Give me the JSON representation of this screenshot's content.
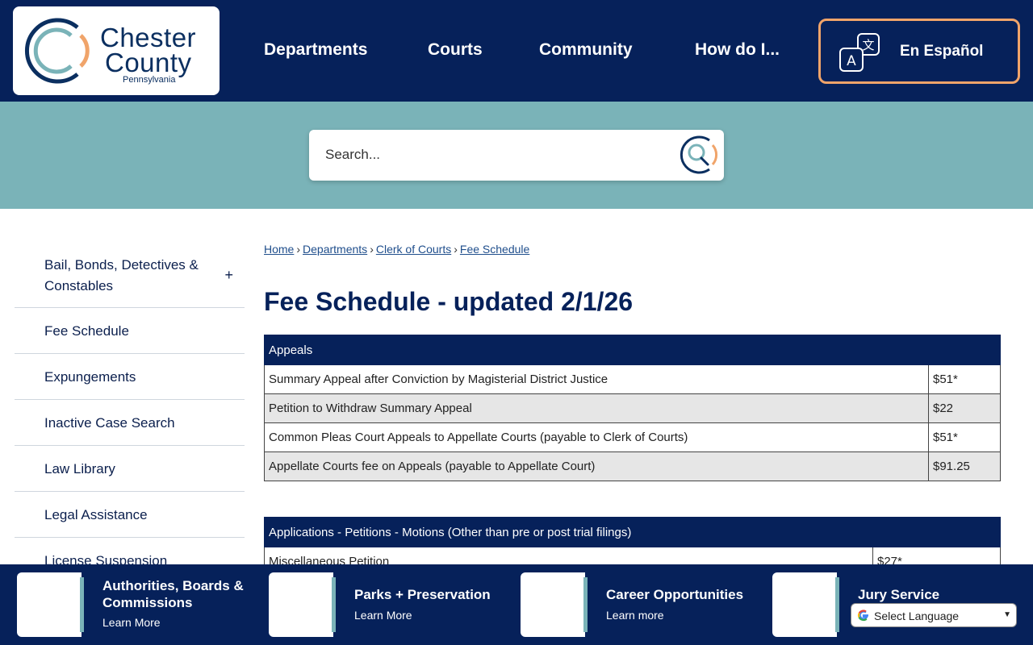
{
  "logo": {
    "line1": "Chester",
    "line2": "County",
    "line3": "Pennsylvania"
  },
  "nav": [
    "Departments",
    "Courts",
    "Community",
    "How do I..."
  ],
  "espanol": "En Español",
  "search": {
    "placeholder": "Search..."
  },
  "sidebar": {
    "items": [
      "Bail, Bonds, Detectives & Constables",
      "Fee Schedule",
      "Expungements",
      "Inactive Case Search",
      "Law Library",
      "Legal Assistance",
      "License Suspension"
    ],
    "expand_symbol": "+"
  },
  "breadcrumb": [
    "Home",
    "Departments",
    "Clerk of Courts",
    "Fee Schedule"
  ],
  "page_title": "Fee Schedule - updated 2/1/26",
  "tables": [
    {
      "header": "Appeals",
      "rows": [
        [
          "Summary Appeal after Conviction by Magisterial District Justice",
          "$51*"
        ],
        [
          "Petition to Withdraw Summary Appeal",
          "$22"
        ],
        [
          "Common Pleas Court Appeals to Appellate Courts (payable to Clerk of Courts)",
          "$51*"
        ],
        [
          "Appellate Courts fee on Appeals (payable to Appellate Court)",
          "$91.25"
        ]
      ]
    },
    {
      "header": "Applications - Petitions - Motions (Other than pre or post trial filings)",
      "rows": [
        [
          "Miscellaneous Petition",
          "$27*"
        ]
      ]
    }
  ],
  "footer_cards": [
    {
      "title": "Authorities, Boards & Commissions",
      "sub": "Learn More"
    },
    {
      "title": "Parks + Preservation",
      "sub": "Learn More"
    },
    {
      "title": "Career Opportunities",
      "sub": "Learn more"
    },
    {
      "title": "Jury Service",
      "sub": ""
    }
  ],
  "translate": {
    "label": "Select Language"
  },
  "colors": {
    "navy": "#06215a",
    "teal": "#7ab3b8",
    "orange": "#f0a46a"
  }
}
